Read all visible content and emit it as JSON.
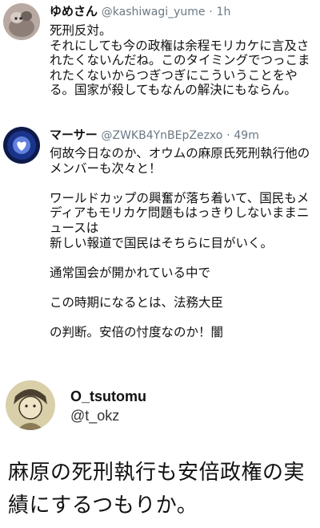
{
  "tweet1": {
    "name": "ゆめさん",
    "handle": "@kashiwagi_yume",
    "sep": "·",
    "time": "1h",
    "text": "死刑反対。\nそれにしても今の政権は余程モリカケに言及されたくないんだね。このタイミングでつっこまれたくないからつぎつぎにこういうことをやる。国家が殺してもなんの解決にもならん。"
  },
  "tweet2": {
    "name": "マーサー",
    "handle": "@ZWKB4YnBEpZezxo",
    "sep": "·",
    "time": "49m",
    "text": "何故今日なのか、オウムの麻原氏死刑執行他のメンバーも次々と！\n\nワールドカップの興奮が落ち着いて、国民もメディアもモリカケ問題もはっきりしないままニュースは\n新しい報道で国民はそちらに目がいく。\n\n通常国会が開かれている中で\n\nこの時期になるとは、法務大臣\n\nの判断。安倍の忖度なのか！闇"
  },
  "profile": {
    "name": "O_tsutomu",
    "handle": "@t_okz"
  },
  "caption": "麻原の死刑執行も安倍政権の実績にするつもりか。",
  "colors": {
    "meta": "#6b7883",
    "text": "#111111"
  },
  "icons": [
    "avatar-cat",
    "avatar-heart",
    "avatar-illustration"
  ]
}
